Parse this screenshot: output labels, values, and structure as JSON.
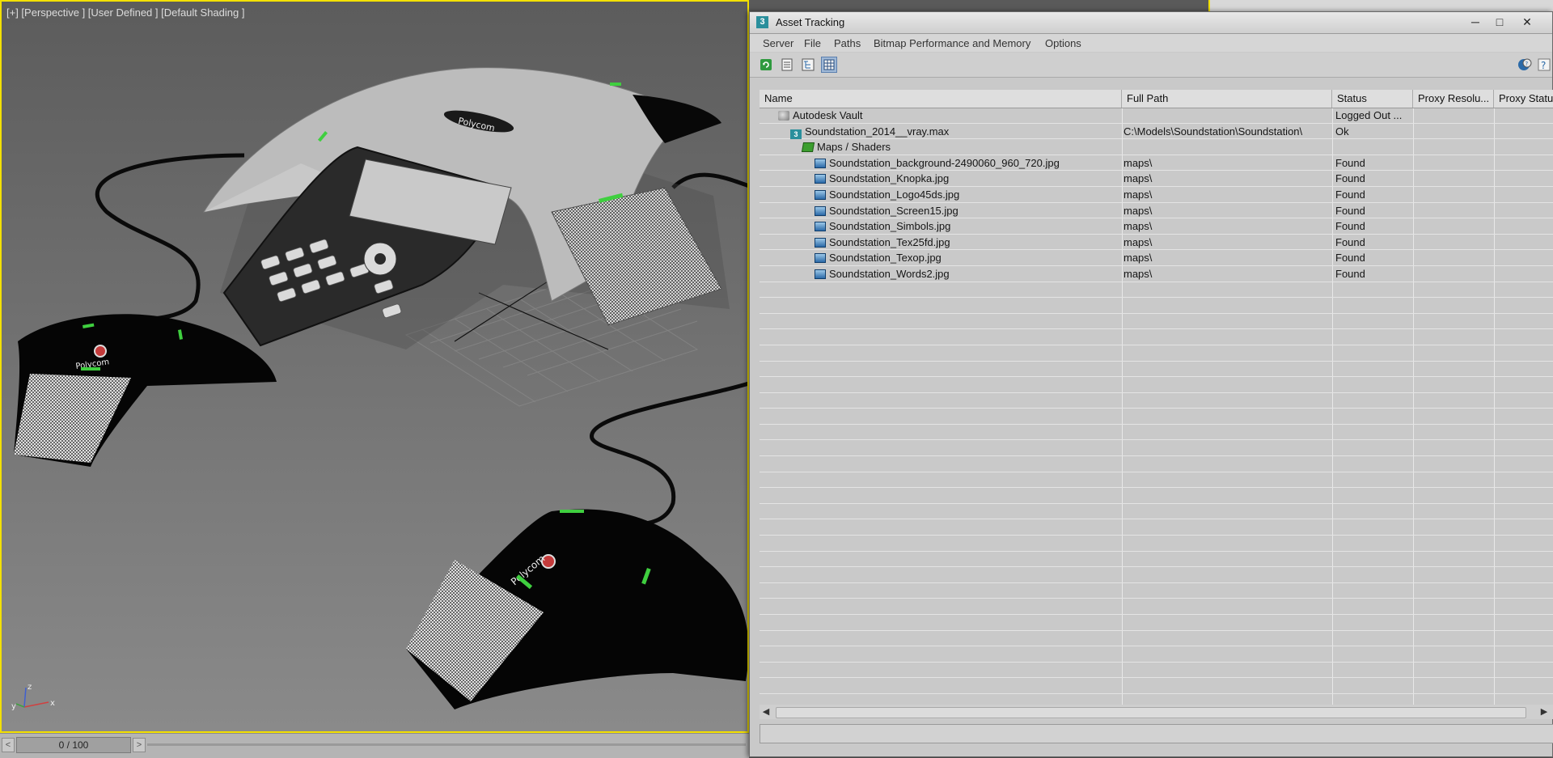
{
  "viewport": {
    "label": "[+] [Perspective ] [User Defined ] [Default Shading ]",
    "axis": {
      "x": "x",
      "y": "y",
      "z": "z"
    }
  },
  "timeline": {
    "value": "0 / 100",
    "prev": "<",
    "next": ">"
  },
  "window": {
    "app_icon": "3",
    "title": "Asset Tracking",
    "minimize": "─",
    "maximize": "□",
    "close": "✕"
  },
  "menu": [
    "Server",
    "File",
    "Paths",
    "Bitmap Performance and Memory",
    "Options"
  ],
  "toolbar": {
    "icons": [
      "refresh-icon",
      "list-view-icon",
      "tree-view-icon",
      "grid-view-icon",
      "vault-help-icon",
      "help-icon"
    ]
  },
  "table": {
    "columns": [
      "Name",
      "Full Path",
      "Status",
      "Proxy Resolu...",
      "Proxy Status"
    ],
    "rows": [
      {
        "indent": 1,
        "icon": "vault",
        "name": "Autodesk Vault",
        "path": "",
        "status": "Logged Out ..."
      },
      {
        "indent": 2,
        "icon": "max",
        "name": "Soundstation_2014__vray.max",
        "path": "C:\\Models\\Soundstation\\Soundstation\\",
        "status": "Ok"
      },
      {
        "indent": 3,
        "icon": "maps",
        "name": "Maps / Shaders",
        "path": "",
        "status": ""
      },
      {
        "indent": 4,
        "icon": "image",
        "name": "Soundstation_background-2490060_960_720.jpg",
        "path": "maps\\",
        "status": "Found"
      },
      {
        "indent": 4,
        "icon": "image",
        "name": "Soundstation_Knopka.jpg",
        "path": "maps\\",
        "status": "Found"
      },
      {
        "indent": 4,
        "icon": "image",
        "name": "Soundstation_Logo45ds.jpg",
        "path": "maps\\",
        "status": "Found"
      },
      {
        "indent": 4,
        "icon": "image",
        "name": "Soundstation_Screen15.jpg",
        "path": "maps\\",
        "status": "Found"
      },
      {
        "indent": 4,
        "icon": "image",
        "name": "Soundstation_Simbols.jpg",
        "path": "maps\\",
        "status": "Found"
      },
      {
        "indent": 4,
        "icon": "image",
        "name": "Soundstation_Tex25fd.jpg",
        "path": "maps\\",
        "status": "Found"
      },
      {
        "indent": 4,
        "icon": "image",
        "name": "Soundstation_Texop.jpg",
        "path": "maps\\",
        "status": "Found"
      },
      {
        "indent": 4,
        "icon": "image",
        "name": "Soundstation_Words2.jpg",
        "path": "maps\\",
        "status": "Found"
      }
    ]
  },
  "scene": {
    "logo_text": "Polycom"
  },
  "colors": {
    "viewport_border": "#f3e000",
    "led_green": "#3fcf3f",
    "device_body": "#050505",
    "device_top": "#bdbdbd"
  }
}
